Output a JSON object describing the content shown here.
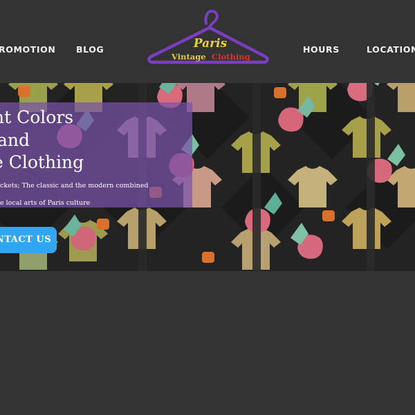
{
  "nav": {
    "left_items": [
      "ROMOTION",
      "BLOG"
    ],
    "right_items": [
      "HOURS",
      "LOCATION"
    ]
  },
  "logo": {
    "line1": "Paris",
    "line2a": "Vintage",
    "line2b": "Clothing",
    "colors": {
      "hanger": "#7a3ec2",
      "paris": "#e8d23a",
      "vintage": "#e6c83a",
      "clothing": "#e2322a"
    }
  },
  "hero": {
    "headline_lines": [
      "nt Colors",
      "and",
      "e Clothing"
    ],
    "tagline_1": "ckets; The classic and the modern combined",
    "tagline_2": "e local arts of Paris culture",
    "cta_label": "NTACT US",
    "colors": {
      "overlay": "#7852aa",
      "cta": "#32a6f0"
    }
  }
}
